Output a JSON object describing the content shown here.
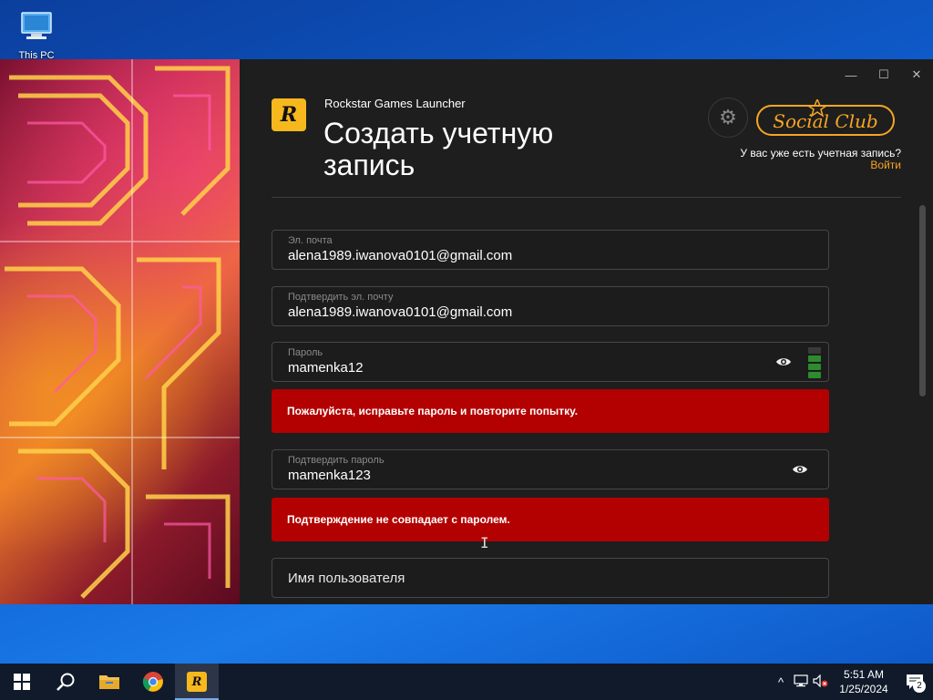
{
  "desktop": {
    "this_pc_label": "This PC"
  },
  "window": {
    "app_name": "Rockstar Games Launcher",
    "page_title": "Создать учетную запись",
    "logo_letter": "R",
    "social_club_logo_text": "Social Club",
    "have_account_text": "У вас уже есть учетная запись?",
    "login_link": "Войти",
    "controls": {
      "minimize": "—",
      "maximize": "☐",
      "close": "✕"
    }
  },
  "form": {
    "email": {
      "label": "Эл. почта",
      "value": "alena1989.iwanova0101@gmail.com"
    },
    "confirm_email": {
      "label": "Подтвердить эл. почту",
      "value": "alena1989.iwanova0101@gmail.com"
    },
    "password": {
      "label": "Пароль",
      "value": "mamenka12",
      "strength_bars_filled": 3,
      "strength_bars_total": 4
    },
    "password_error": "Пожалуйста, исправьте пароль и повторите попытку.",
    "confirm_password": {
      "label": "Подтвердить пароль",
      "value": "mamenka123"
    },
    "confirm_password_error": "Подтверждение не совпадает с паролем.",
    "username": {
      "placeholder": "Имя пользователя"
    }
  },
  "taskbar": {
    "time": "5:51 AM",
    "date": "1/25/2024",
    "notification_count": "2",
    "icons": [
      "windows-start-icon",
      "search-icon",
      "file-explorer-icon",
      "chrome-icon",
      "rockstar-launcher-icon"
    ]
  },
  "colors": {
    "accent": "#f6a623",
    "error_bg": "#b30000",
    "strength_green": "#2e8b2e",
    "window_bg": "#1e1e1f"
  }
}
